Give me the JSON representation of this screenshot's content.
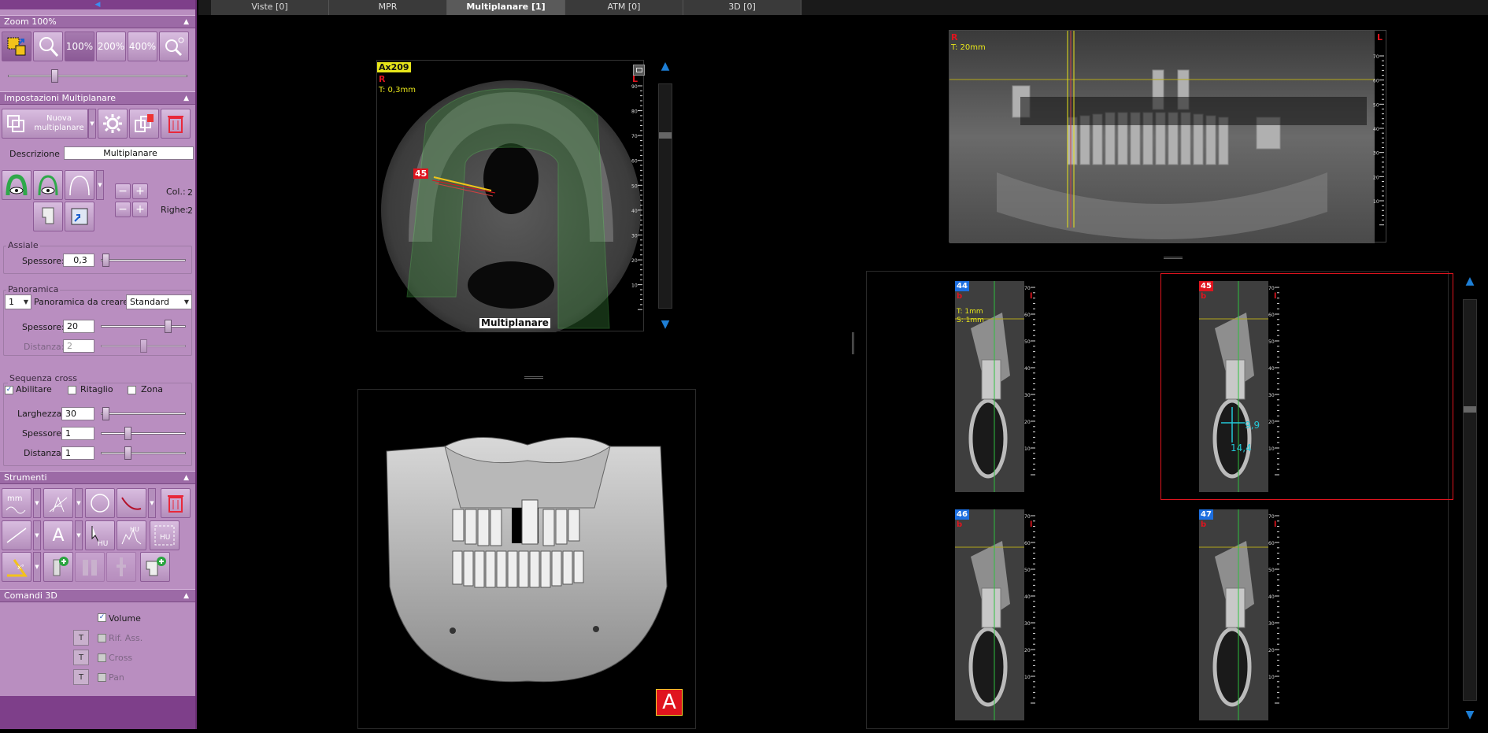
{
  "sidebar": {
    "collapse_arrow": "◀",
    "zoom": {
      "title": "Zoom 100%",
      "buttons": [
        {
          "icon": "zoom-fit-icon",
          "label": ""
        },
        {
          "icon": "magnifier-icon",
          "label": ""
        },
        {
          "icon": "",
          "label": "100%"
        },
        {
          "icon": "",
          "label": "200%"
        },
        {
          "icon": "",
          "label": "400%"
        },
        {
          "icon": "zoom-settings-icon",
          "label": ""
        }
      ],
      "slider_value": 0.25
    },
    "multiplanar": {
      "title": "Impostazioni Multiplanare",
      "new_label": "Nuova multiplanare",
      "descr_label": "Descrizione",
      "descr_value": "Multiplanare",
      "col_label": "Col.:",
      "col_value": "2",
      "rows_label": "Righe:",
      "rows_value": "2",
      "axial": {
        "title": "Assiale",
        "thickness_label": "Spessore:",
        "thickness_value": "0,3",
        "slider_value": 0.02
      },
      "panoramic": {
        "title": "Panoramica",
        "count_value": "1",
        "create_label": "Panoramica da creare",
        "create_value": "Standard",
        "thickness_label": "Spessore:",
        "thickness_value": "20",
        "thickness_slider": 0.82,
        "distance_label": "Distanza:",
        "distance_value": "2",
        "distance_slider": 0.5
      },
      "cross": {
        "title": "Sequenza cross",
        "enable_label": "Abilitare",
        "crop_label": "Ritaglio",
        "zone_label": "Zona",
        "width_label": "Larghezza:",
        "width_value": "30",
        "width_slider": 0.02,
        "thickness_label": "Spessore:",
        "thickness_value": "1",
        "thickness_slider": 0.3,
        "distance_label": "Distanza:",
        "distance_value": "1",
        "distance_slider": 0.3
      }
    },
    "tools": {
      "title": "Strumenti",
      "hu_label": "HU",
      "mm_label": "mm",
      "a_label": "A"
    },
    "commands3d": {
      "title": "Comandi 3D",
      "volume_label": "Volume",
      "ref_label": "Rif. Ass.",
      "cross_label": "Cross",
      "pan_label": "Pan",
      "t_label": "T"
    }
  },
  "tabs": [
    {
      "label": "Viste [0]"
    },
    {
      "label": "MPR"
    },
    {
      "label": "Multiplanare [1]"
    },
    {
      "label": "ATM [0]"
    },
    {
      "label": "3D [0]"
    }
  ],
  "axial_view": {
    "slice_tag": "Ax209",
    "orient_r": "R",
    "orient_l": "L",
    "thickness": "T: 0,3mm",
    "cross_tag": "45",
    "bottom_label": "Multiplanare",
    "ruler_ticks": [
      "90",
      "80",
      "70",
      "60",
      "50",
      "40",
      "30",
      "20",
      "10"
    ],
    "scroll_value": 0.22
  },
  "pano_view": {
    "orient_r": "R",
    "orient_l": "L",
    "thickness": "T: 20mm",
    "ruler_ticks": [
      "70",
      "60",
      "50",
      "40",
      "30",
      "20",
      "10"
    ]
  },
  "cross_views": [
    {
      "tag": "44",
      "orient_b": "b",
      "orient_l": "l",
      "t_label": "T: 1mm",
      "s_label": "S: 1mm",
      "selected": false
    },
    {
      "tag": "45",
      "orient_b": "b",
      "orient_l": "l",
      "t_label": "",
      "s_label": "",
      "selected": true,
      "measure_a": "9,9",
      "measure_b": "14,4"
    },
    {
      "tag": "46",
      "orient_b": "b",
      "orient_l": "l",
      "t_label": "",
      "s_label": "",
      "selected": false
    },
    {
      "tag": "47",
      "orient_b": "b",
      "orient_l": "l",
      "t_label": "",
      "s_label": "",
      "selected": false
    }
  ],
  "cross_ruler_ticks": [
    "70",
    "60",
    "50",
    "40",
    "30",
    "20",
    "10"
  ],
  "view3d": {
    "orientation_badge": "A"
  },
  "right_scroll_value": 0.27,
  "colors": {
    "accent_purple": "#7e3f8a",
    "panel_purple": "#b98ec0",
    "select_red": "#e0141e",
    "tag_blue": "#1d6fe0",
    "tag_yellow": "#e7e51a",
    "measure_cyan": "#22c8d8"
  }
}
